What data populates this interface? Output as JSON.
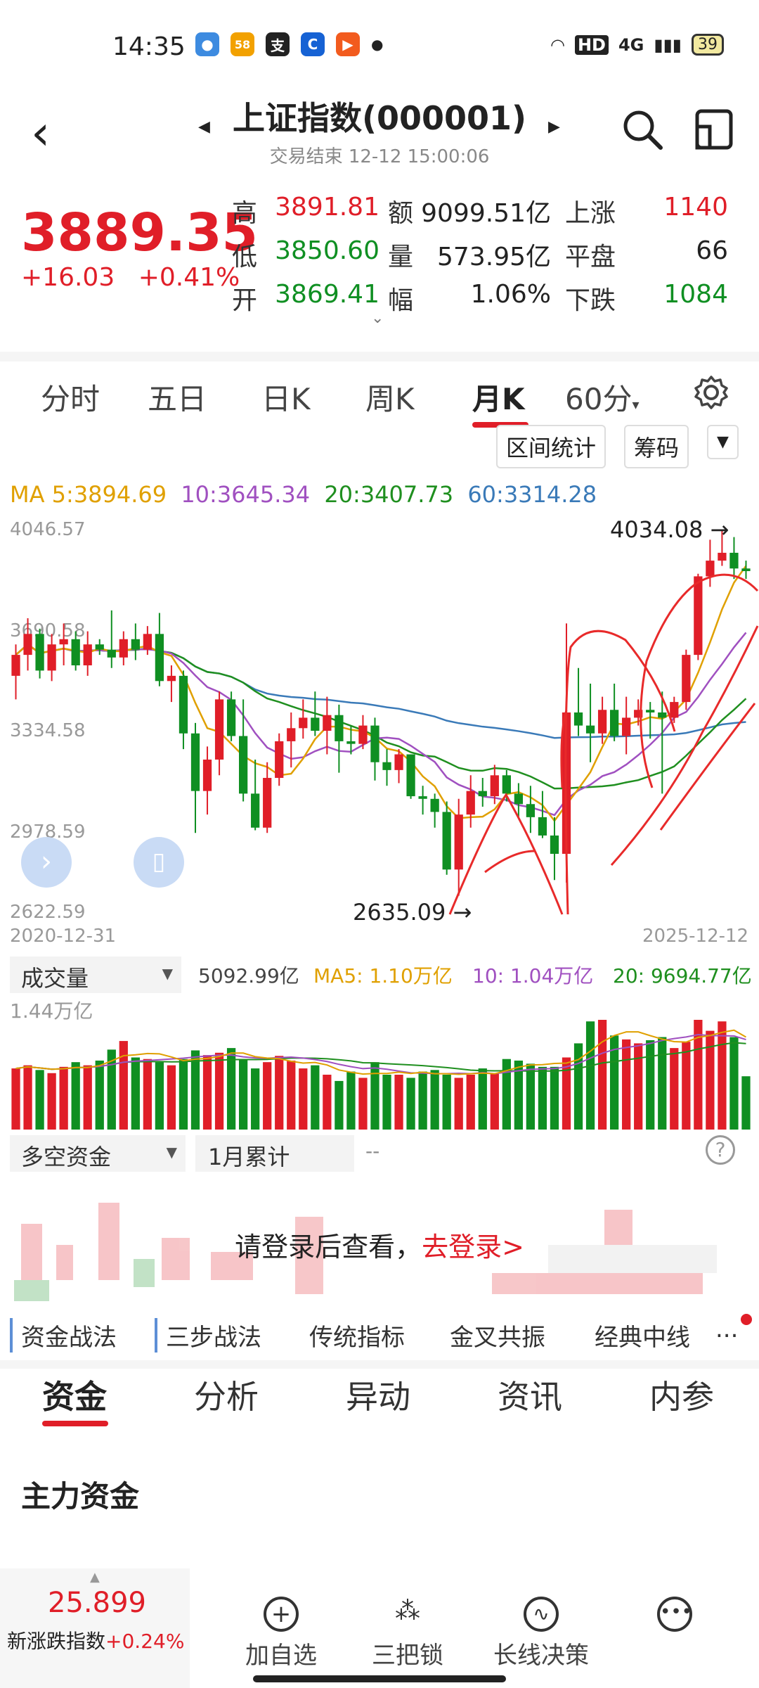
{
  "status": {
    "time": "14:35",
    "battery": "39",
    "network": "4G",
    "hd": "HD"
  },
  "header": {
    "title": "上证指数(000001)",
    "subtitle": "交易结束 12-12 15:00:06"
  },
  "quote": {
    "price": "3889.35",
    "change": "+16.03",
    "change_pct": "+0.41%",
    "high_label": "高",
    "high": "3891.81",
    "low_label": "低",
    "low": "3850.60",
    "open_label": "开",
    "open": "3869.41",
    "amount_label": "额",
    "amount": "9099.51亿",
    "volume_label": "量",
    "volume": "573.95亿",
    "amplitude_label": "幅",
    "amplitude": "1.06%",
    "up_label": "上涨",
    "up": "1140",
    "flat_label": "平盘",
    "flat": "66",
    "down_label": "下跌",
    "down": "1084"
  },
  "tabs": [
    "分时",
    "五日",
    "日K",
    "周K",
    "月K",
    "60分"
  ],
  "active_tab": "月K",
  "tools": {
    "interval": "区间统计",
    "chips": "筹码"
  },
  "ma": {
    "ma5": "MA 5:3894.69",
    "ma10": "10:3645.34",
    "ma20": "20:3407.73",
    "ma60": "60:3314.28"
  },
  "colors": {
    "up": "#e01e28",
    "down": "#0f8f22",
    "ma5": "#e0a000",
    "ma10": "#a050c0",
    "ma20": "#1f8f1f",
    "ma60": "#3a7ab8",
    "annot": "#e82a2a"
  },
  "chart_data": {
    "type": "candlestick",
    "y_ticks": [
      "4046.57",
      "3690.58",
      "3334.58",
      "2978.59",
      "2622.59"
    ],
    "ylim": [
      2622.59,
      4046.57
    ],
    "x_start": "2020-12-31",
    "x_end": "2025-12-12",
    "high_label": "4034.08",
    "low_label": "2635.09",
    "candles": [
      [
        3480,
        3560,
        3390,
        3600
      ],
      [
        3560,
        3640,
        3500,
        3700
      ],
      [
        3640,
        3500,
        3470,
        3660
      ],
      [
        3500,
        3600,
        3460,
        3640
      ],
      [
        3600,
        3620,
        3520,
        3680
      ],
      [
        3620,
        3520,
        3500,
        3650
      ],
      [
        3520,
        3600,
        3480,
        3650
      ],
      [
        3600,
        3580,
        3560,
        3620
      ],
      [
        3580,
        3550,
        3510,
        3730
      ],
      [
        3550,
        3620,
        3520,
        3650
      ],
      [
        3620,
        3580,
        3540,
        3680
      ],
      [
        3580,
        3640,
        3560,
        3670
      ],
      [
        3640,
        3460,
        3440,
        3720
      ],
      [
        3460,
        3480,
        3380,
        3520
      ],
      [
        3480,
        3260,
        3200,
        3500
      ],
      [
        3260,
        3040,
        2880,
        3300
      ],
      [
        3040,
        3160,
        2950,
        3210
      ],
      [
        3160,
        3390,
        3100,
        3420
      ],
      [
        3390,
        3250,
        3230,
        3420
      ],
      [
        3250,
        3030,
        3000,
        3390
      ],
      [
        3030,
        2900,
        2890,
        3160
      ],
      [
        2900,
        3090,
        2880,
        3150
      ],
      [
        3090,
        3230,
        3060,
        3260
      ],
      [
        3230,
        3280,
        3130,
        3340
      ],
      [
        3280,
        3320,
        3240,
        3390
      ],
      [
        3320,
        3270,
        3250,
        3420
      ],
      [
        3270,
        3330,
        3180,
        3400
      ],
      [
        3330,
        3230,
        3110,
        3370
      ],
      [
        3230,
        3220,
        3180,
        3290
      ],
      [
        3220,
        3290,
        3200,
        3330
      ],
      [
        3290,
        3150,
        3080,
        3320
      ],
      [
        3150,
        3120,
        3060,
        3200
      ],
      [
        3120,
        3180,
        3070,
        3200
      ],
      [
        3180,
        3020,
        3010,
        3180
      ],
      [
        3020,
        3010,
        2950,
        3060
      ],
      [
        3010,
        2960,
        2900,
        3030
      ],
      [
        2960,
        2740,
        2720,
        3000
      ],
      [
        2740,
        2950,
        2640,
        3010
      ],
      [
        2950,
        3040,
        2900,
        3100
      ],
      [
        3040,
        3020,
        2980,
        3090
      ],
      [
        3020,
        3100,
        2990,
        3140
      ],
      [
        3100,
        3030,
        3000,
        3120
      ],
      [
        3030,
        2990,
        2940,
        3070
      ],
      [
        2990,
        2940,
        2880,
        3060
      ],
      [
        2940,
        2870,
        2860,
        3040
      ],
      [
        2870,
        2800,
        2700,
        2940
      ],
      [
        2800,
        3340,
        2690,
        3680
      ],
      [
        3340,
        3290,
        3250,
        3510
      ],
      [
        3290,
        3260,
        3150,
        3450
      ],
      [
        3260,
        3350,
        3220,
        3400
      ],
      [
        3350,
        3250,
        3230,
        3450
      ],
      [
        3250,
        3320,
        3180,
        3400
      ],
      [
        3320,
        3350,
        3290,
        3390
      ],
      [
        3350,
        3340,
        3240,
        3380
      ],
      [
        3340,
        3320,
        3030,
        3420
      ],
      [
        3320,
        3380,
        3300,
        3400
      ],
      [
        3380,
        3560,
        3350,
        3580
      ],
      [
        3560,
        3860,
        3540,
        3870
      ],
      [
        3860,
        3920,
        3820,
        4000
      ],
      [
        3920,
        3950,
        3900,
        4034
      ],
      [
        3950,
        3890,
        3850,
        4010
      ],
      [
        3890,
        3880,
        3850,
        3920
      ]
    ],
    "volume_label": "成交量",
    "volume_value": "5092.99亿",
    "vol_ma5": "MA5: 1.10万亿",
    "vol_ma10": "10: 1.04万亿",
    "vol_ma20": "20: 9694.77亿",
    "vol_max": "1.44万亿",
    "volumes": [
      0.78,
      0.82,
      0.76,
      0.72,
      0.8,
      0.86,
      0.82,
      0.88,
      1.02,
      1.13,
      0.92,
      0.9,
      0.86,
      0.82,
      0.9,
      1.01,
      0.95,
      0.98,
      1.04,
      0.9,
      0.78,
      0.86,
      0.94,
      0.88,
      0.78,
      0.82,
      0.7,
      0.62,
      0.74,
      0.66,
      0.86,
      0.7,
      0.7,
      0.66,
      0.74,
      0.76,
      0.7,
      0.66,
      0.7,
      0.78,
      0.72,
      0.9,
      0.88,
      0.84,
      0.8,
      0.8,
      0.92,
      1.1,
      1.38,
      1.4,
      1.2,
      1.15,
      1.1,
      1.14,
      1.18,
      1.04,
      1.12,
      1.4,
      1.26,
      1.38,
      1.18,
      0.68
    ]
  },
  "capital": {
    "label": "多空资金",
    "period": "1月累计",
    "dash": "--",
    "login_text": "请登录后查看，",
    "login_link": "去登录>"
  },
  "strategies": [
    "资金战法",
    "三步战法",
    "传统指标",
    "金叉共振",
    "经典中线",
    "..."
  ],
  "bottom_tabs": [
    "资金",
    "分析",
    "异动",
    "资讯",
    "内参"
  ],
  "section_title": "主力资金",
  "footer": {
    "index_value": "25.899",
    "index_name": "新涨跌指数",
    "index_change": "+0.24%",
    "add": "加自选",
    "lock": "三把锁",
    "decision": "长线决策"
  }
}
